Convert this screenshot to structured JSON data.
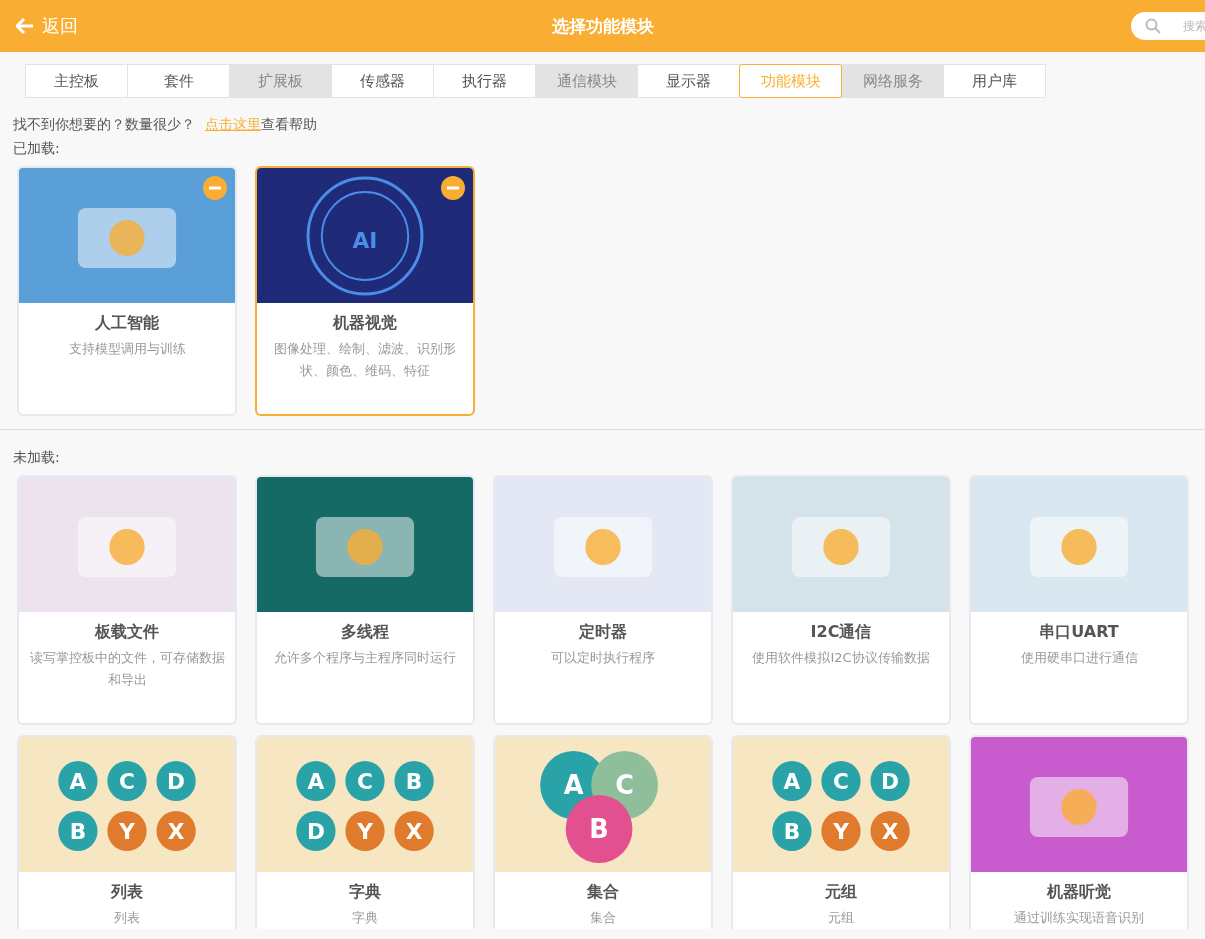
{
  "header": {
    "back": "返回",
    "title": "选择功能模块",
    "search": {
      "placeholder": "搜索"
    }
  },
  "tabs": [
    {
      "label": "主控板",
      "selected": false,
      "disabled": false
    },
    {
      "label": "套件",
      "selected": false,
      "disabled": false
    },
    {
      "label": "扩展板",
      "selected": false,
      "disabled": true
    },
    {
      "label": "传感器",
      "selected": false,
      "disabled": false
    },
    {
      "label": "执行器",
      "selected": false,
      "disabled": false
    },
    {
      "label": "通信模块",
      "selected": false,
      "disabled": true
    },
    {
      "label": "显示器",
      "selected": false,
      "disabled": false
    },
    {
      "label": "功能模块",
      "selected": true,
      "disabled": false
    },
    {
      "label": "网络服务",
      "selected": false,
      "disabled": true
    },
    {
      "label": "用户库",
      "selected": false,
      "disabled": false
    }
  ],
  "help": {
    "text": "找不到你想要的？数量很少？",
    "link": "点击这里",
    "after": "查看帮助"
  },
  "sections": [
    {
      "title": "已加载:",
      "cards": [
        {
          "title": "人工智能",
          "desc": "支持模型调用与训练",
          "color": "#5a9fd8",
          "removable": true,
          "selected": false
        },
        {
          "title": "机器视觉",
          "desc": "图像处理、绘制、滤波、识别形状、颜色、维码、特征",
          "color": "#1f2a78",
          "removable": true,
          "selected": true,
          "letters": [
            {
              "text": "AI",
              "color": "#4a8ee8"
            }
          ]
        }
      ]
    },
    {
      "title": "未加载:",
      "cards": [
        {
          "title": "板载文件",
          "desc": "读写掌控板中的文件，可存储数据和导出",
          "color": "#ece3ee",
          "removable": false,
          "selected": false
        },
        {
          "title": "多线程",
          "desc": "允许多个程序与主程序同时运行",
          "color": "#156a66",
          "removable": false,
          "selected": false
        },
        {
          "title": "定时器",
          "desc": "可以定时执行程序",
          "color": "#e3e8f4",
          "removable": false,
          "selected": false
        },
        {
          "title": "I2C通信",
          "desc": "使用软件模拟I2C协议传输数据",
          "color": "#d4e3ea",
          "removable": false,
          "selected": false
        },
        {
          "title": "串口UART",
          "desc": "使用硬串口进行通信",
          "color": "#d9e8f0",
          "removable": false,
          "selected": false
        },
        {
          "title": "列表",
          "desc": "列表",
          "color": "#f7e6c2",
          "removable": false,
          "selected": false,
          "letters": [
            {
              "text": "A",
              "color": "#2aa3a8"
            },
            {
              "text": "C",
              "color": "#2aa3a8"
            },
            {
              "text": "D",
              "color": "#2aa3a8"
            },
            {
              "text": "B",
              "color": "#2aa3a8"
            },
            {
              "text": "Y",
              "color": "#e07b2e"
            },
            {
              "text": "X",
              "color": "#e07b2e"
            }
          ]
        },
        {
          "title": "字典",
          "desc": "字典",
          "color": "#f7e6c2",
          "removable": false,
          "selected": false,
          "letters": [
            {
              "text": "A",
              "color": "#2aa3a8"
            },
            {
              "text": "C",
              "color": "#2aa3a8"
            },
            {
              "text": "B",
              "color": "#2aa3a8"
            },
            {
              "text": "D",
              "color": "#2aa3a8"
            },
            {
              "text": "Y",
              "color": "#e07b2e"
            },
            {
              "text": "X",
              "color": "#e07b2e"
            }
          ]
        },
        {
          "title": "集合",
          "desc": "集合",
          "color": "#f7e6c2",
          "removable": false,
          "selected": false,
          "letters": [
            {
              "text": "A",
              "color": "#2aa3a8"
            },
            {
              "text": "C",
              "color": "#8fbf9a"
            },
            {
              "text": "B",
              "color": "#e2508f"
            }
          ]
        },
        {
          "title": "元组",
          "desc": "元组",
          "color": "#f7e6c2",
          "removable": false,
          "selected": false,
          "letters": [
            {
              "text": "A",
              "color": "#2aa3a8"
            },
            {
              "text": "C",
              "color": "#2aa3a8"
            },
            {
              "text": "D",
              "color": "#2aa3a8"
            },
            {
              "text": "B",
              "color": "#2aa3a8"
            },
            {
              "text": "Y",
              "color": "#e07b2e"
            },
            {
              "text": "X",
              "color": "#e07b2e"
            }
          ]
        },
        {
          "title": "机器听觉",
          "desc": "通过训练实现语音识别",
          "color": "#c85ccf",
          "removable": false,
          "selected": false
        }
      ]
    }
  ]
}
